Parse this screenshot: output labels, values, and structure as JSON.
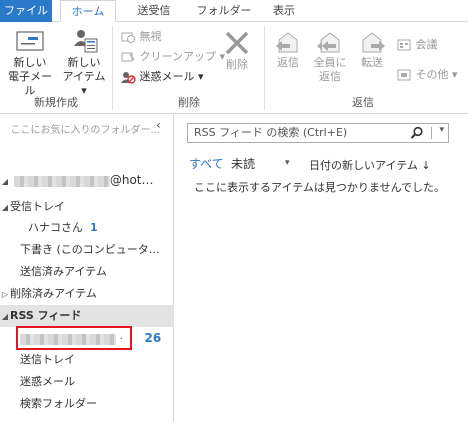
{
  "tabs": {
    "file": "ファイル",
    "home": "ホーム",
    "send_receive": "送受信",
    "folder": "フォルダー",
    "view": "表示"
  },
  "ribbon": {
    "new_email": [
      "新しい",
      "電子メール"
    ],
    "new_items": [
      "新しい",
      "アイテム ▾"
    ],
    "ignore": "無視",
    "cleanup": "クリーンアップ ▾",
    "junk": "迷惑メール ▾",
    "delete": "削除",
    "reply": "返信",
    "reply_all": [
      "全員に",
      "返信"
    ],
    "forward": "転送",
    "meeting": "会議",
    "more": "その他 ▾",
    "group_new": "新規作成",
    "group_delete": "削除",
    "group_respond": "返信"
  },
  "nav": {
    "fav_hint": "ここにお気に入りのフォルダー...",
    "collapse": "‹",
    "account_suffix": "@hot…",
    "inbox": "受信トレイ",
    "inbox_sub": "ハナコさん",
    "inbox_sub_count": "1",
    "drafts": "下書き (このコンピュータ…",
    "sent": "送信済みアイテム",
    "deleted": "削除済みアイテム",
    "rss": "RSS フィード",
    "rss_feed_count": "26",
    "outbox": "送信トレイ",
    "junk": "迷惑メール",
    "search_folders": "検索フォルダー"
  },
  "main": {
    "search_placeholder": "RSS フィード の検索 (Ctrl+E)",
    "filter_all": "すべて",
    "filter_unread": "未読",
    "sort_label": "日付の新しいアイテム ↓",
    "empty_message": "ここに表示するアイテムは見つかりませんでした。"
  },
  "colors": {
    "accent": "#2b79c9",
    "highlight": "#e4151f"
  }
}
